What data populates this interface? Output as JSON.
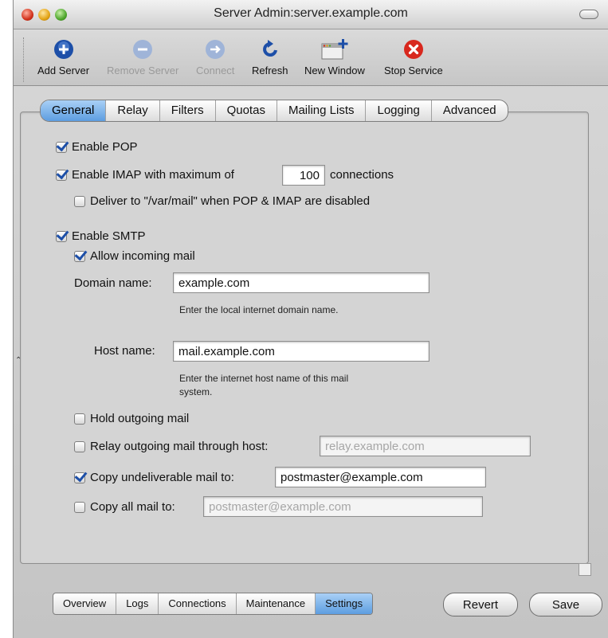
{
  "window": {
    "title": "Server Admin:server.example.com"
  },
  "toolbar": {
    "add_server": "Add Server",
    "remove_server": "Remove Server",
    "connect": "Connect",
    "refresh": "Refresh",
    "new_window": "New Window",
    "stop_service": "Stop Service"
  },
  "tabs": {
    "general": "General",
    "relay": "Relay",
    "filters": "Filters",
    "quotas": "Quotas",
    "mailing_lists": "Mailing Lists",
    "logging": "Logging",
    "advanced": "Advanced",
    "active": "General"
  },
  "form": {
    "enable_pop": {
      "label": "Enable POP",
      "checked": true
    },
    "enable_imap": {
      "label": "Enable IMAP with maximum of",
      "checked": true,
      "value": "100",
      "suffix": "connections"
    },
    "deliver_var_mail": {
      "label": "Deliver to \"/var/mail\" when POP & IMAP are disabled",
      "checked": false
    },
    "enable_smtp": {
      "label": "Enable SMTP",
      "checked": true
    },
    "allow_incoming": {
      "label": "Allow incoming mail",
      "checked": true
    },
    "domain_name": {
      "label": "Domain name:",
      "value": "example.com",
      "help": "Enter the local internet domain name."
    },
    "host_name": {
      "label": "Host name:",
      "value": "mail.example.com",
      "help_line1": "Enter the internet host name of this mail",
      "help_line2": "system."
    },
    "hold_outgoing": {
      "label": "Hold outgoing mail",
      "checked": false
    },
    "relay_outgoing": {
      "label": "Relay outgoing mail through host:",
      "checked": false,
      "value": "relay.example.com"
    },
    "copy_undeliverable": {
      "label": "Copy undeliverable mail to:",
      "checked": true,
      "value": "postmaster@example.com"
    },
    "copy_all": {
      "label": "Copy all mail to:",
      "checked": false,
      "value": "postmaster@example.com"
    }
  },
  "bottom_tabs": {
    "overview": "Overview",
    "logs": "Logs",
    "connections": "Connections",
    "maintenance": "Maintenance",
    "settings": "Settings",
    "active": "Settings"
  },
  "buttons": {
    "revert": "Revert",
    "save": "Save"
  },
  "colors": {
    "accent": "#5d9de0",
    "stop": "#d8281e",
    "brand_blue": "#1d4fa8"
  }
}
